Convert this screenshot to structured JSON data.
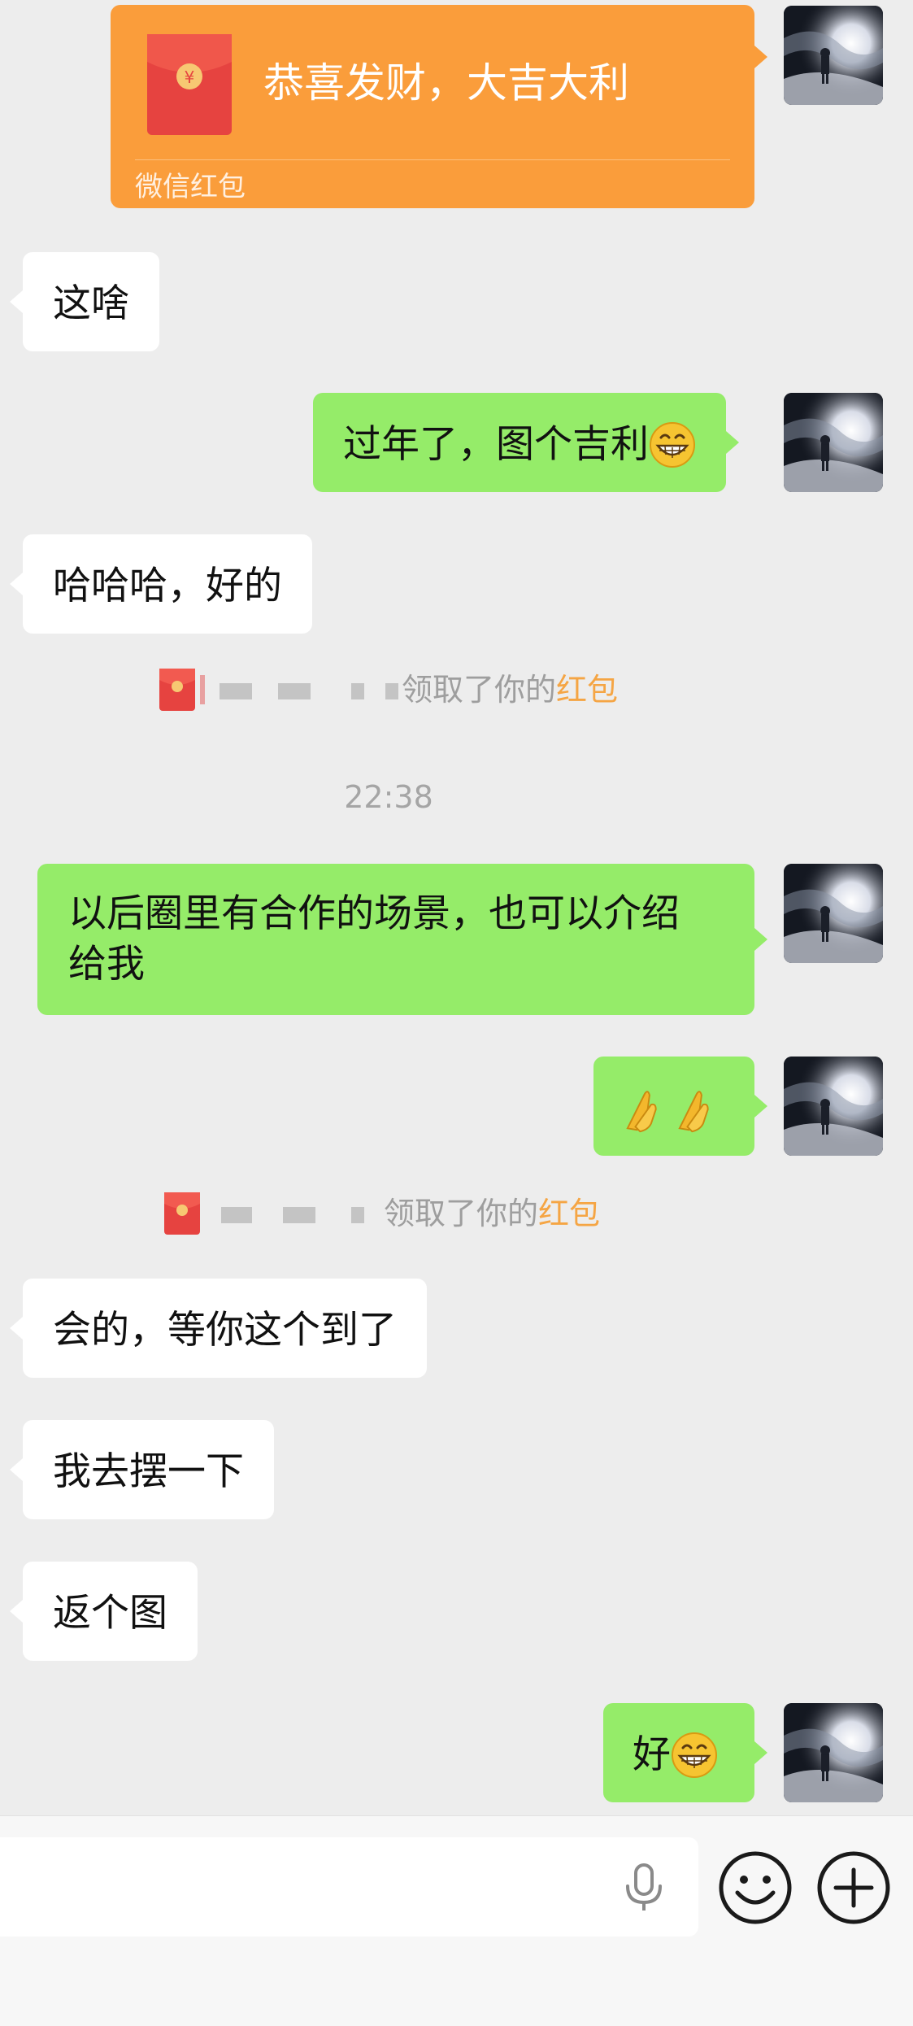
{
  "red_packet": {
    "title": "恭喜发财，大吉大利",
    "footer": "微信红包"
  },
  "messages": {
    "m1": "这啥",
    "m2": "过年了，图个吉利",
    "m3": "哈哈哈，好的",
    "m4_line1": "以后圈里有合作的场景，也可以介绍",
    "m4_line2": "给我",
    "m6": "会的，等你这个到了",
    "m7": "我去摆一下",
    "m8": "返个图",
    "m9": "好"
  },
  "notices": {
    "n1_text": "领取了你的",
    "n1_link": "红包",
    "n2_text": "领取了你的",
    "n2_link": "红包"
  },
  "timestamp": "22:38",
  "icons": {
    "grin_emoji": "grinning-face-emoji",
    "praying_hands_emoji": "praying-hands-emoji",
    "mic": "microphone-icon",
    "smiley": "emoji-smiley-icon",
    "plus": "plus-circle-icon"
  },
  "colors": {
    "background": "#ededed",
    "sent_bubble": "#95ec69",
    "received_bubble": "#ffffff",
    "red_packet": "#fa9d3b",
    "notice_link": "#f5a544",
    "timestamp": "#a5a5a5"
  }
}
